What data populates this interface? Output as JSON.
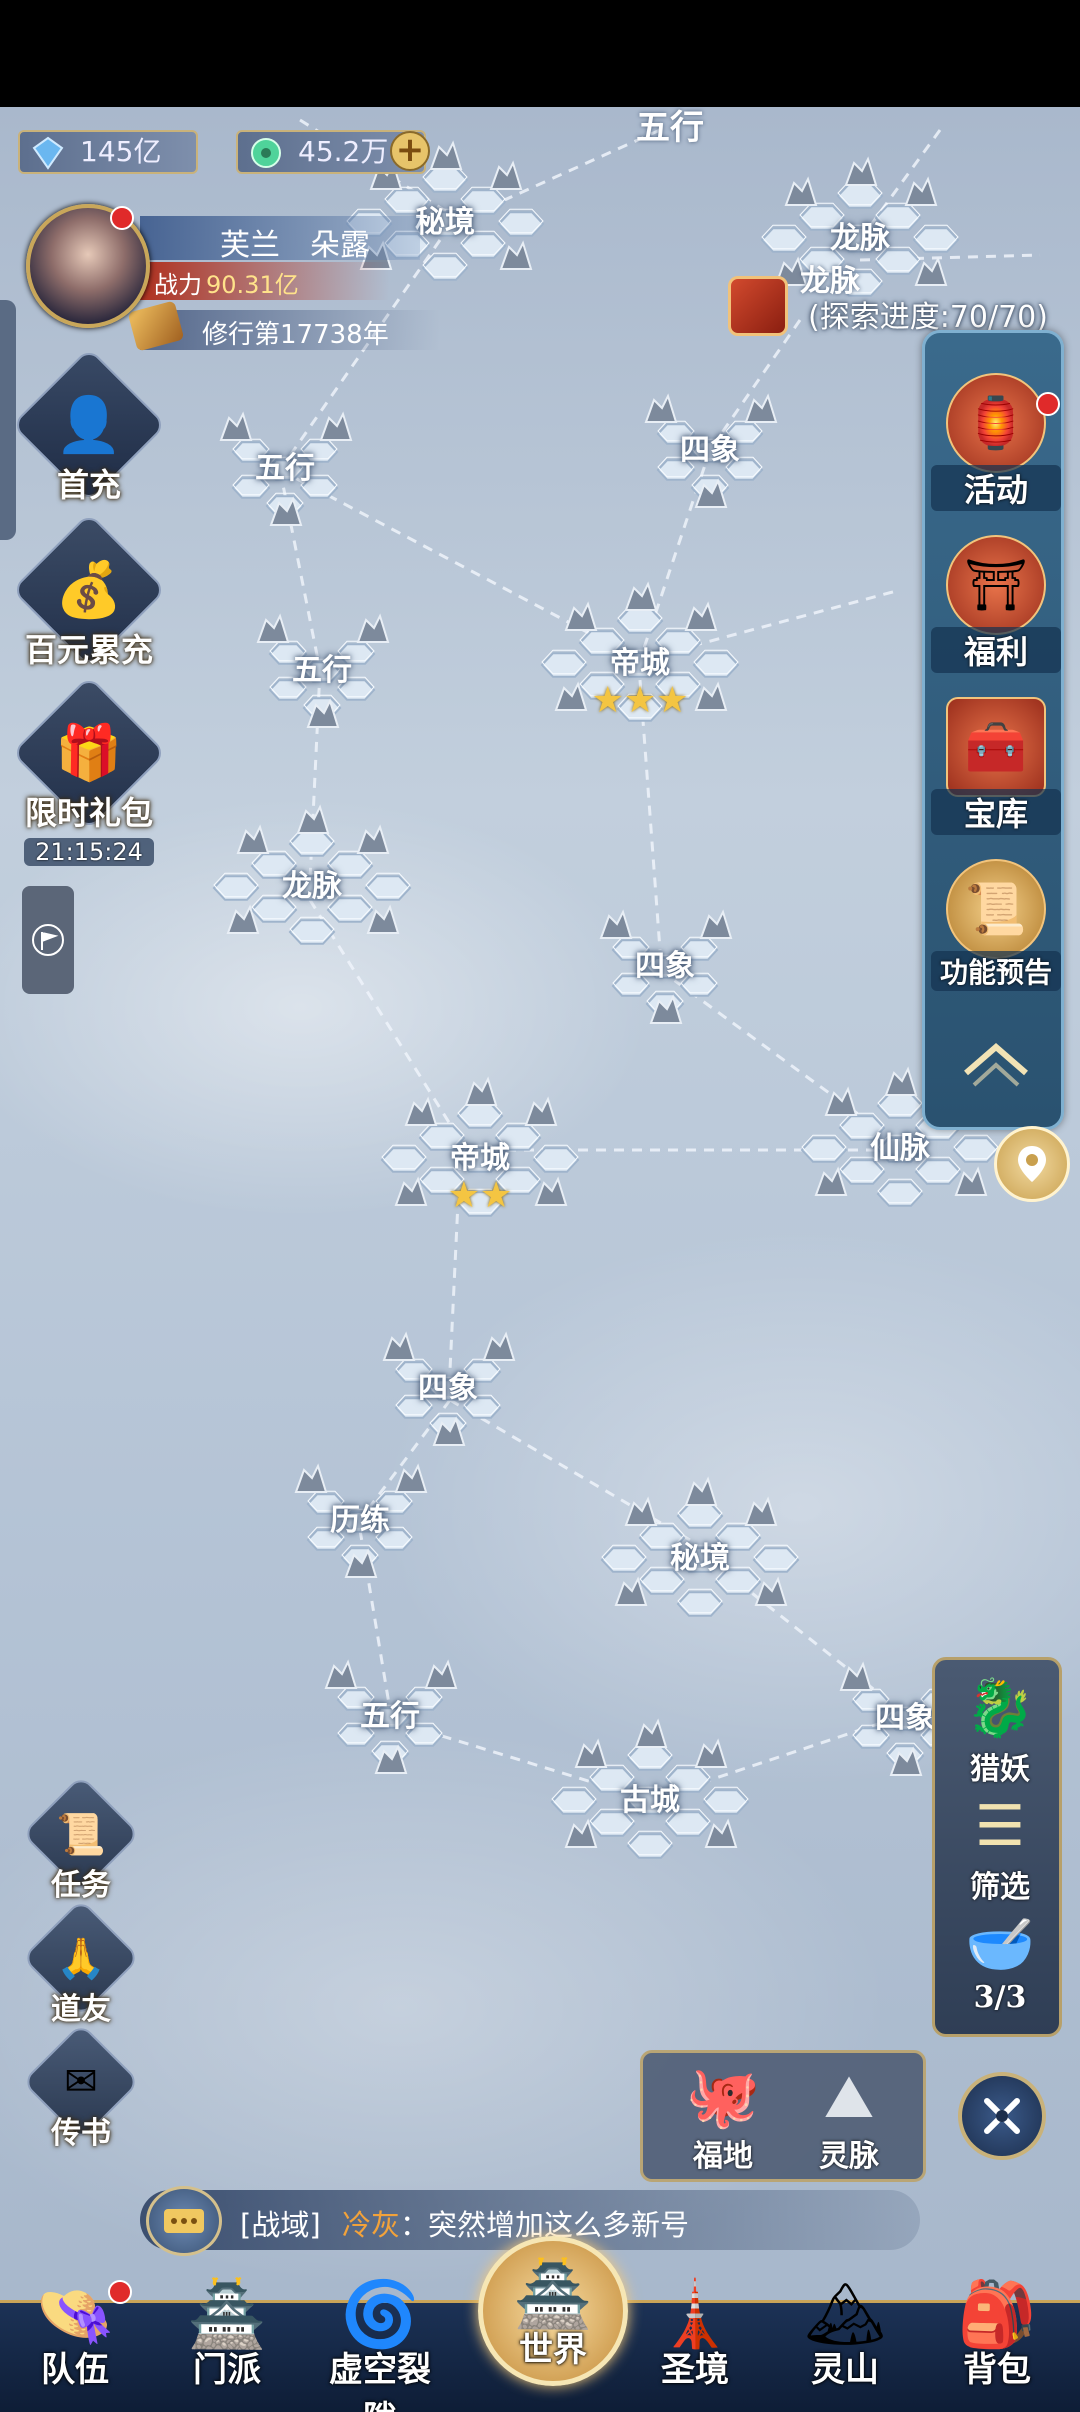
{
  "currencies": [
    {
      "name": "spirit-stone",
      "value": "145亿",
      "icon": "crystal-icon",
      "color": "#6ab7f0"
    },
    {
      "name": "jade",
      "value": "45.2万",
      "icon": "jade-coin-icon",
      "color": "#4fd39a"
    }
  ],
  "player": {
    "name": "芙兰　朵露",
    "power_label": "战力",
    "power_value": "90.31亿",
    "cultivation": "修行第17738年"
  },
  "left_buttons": [
    {
      "label": "首充",
      "icon": "warrior-portrait-icon"
    },
    {
      "label": "百元累充",
      "icon": "money-bag-icon"
    },
    {
      "label": "限时礼包",
      "icon": "gift-bag-icon",
      "timer": "21:15:24"
    }
  ],
  "left_bottom_buttons": [
    {
      "label": "任务",
      "icon": "scroll-icon"
    },
    {
      "label": "道友",
      "icon": "friends-icon"
    },
    {
      "label": "传书",
      "icon": "letter-icon"
    }
  ],
  "right_panel": [
    {
      "label": "活动",
      "icon": "lantern-icon"
    },
    {
      "label": "福利",
      "icon": "pavilion-icon"
    },
    {
      "label": "宝库",
      "icon": "treasure-chest-icon"
    },
    {
      "label": "功能预告",
      "icon": "scroll-preview-icon"
    }
  ],
  "right_lower_panel": [
    {
      "label": "猎妖",
      "icon": "beast-icon"
    },
    {
      "label": "筛选",
      "icon": "filter-icon"
    },
    {
      "label": "3/3",
      "icon": "bowl-icon"
    }
  ],
  "popup_buttons": [
    {
      "label": "福地",
      "icon": "octopus-icon"
    },
    {
      "label": "灵脉",
      "icon": "vein-icon"
    }
  ],
  "map": {
    "top_partial_label": "五行",
    "explore": {
      "node": "龙脉",
      "progress": "(探索进度:70/70)"
    },
    "nodes": [
      {
        "id": "mijing-top",
        "label": "秘境",
        "stars": ""
      },
      {
        "id": "longmai-top",
        "label": "龙脉",
        "stars": ""
      },
      {
        "id": "wuxing-1",
        "label": "五行",
        "stars": ""
      },
      {
        "id": "sixiang-1",
        "label": "四象",
        "stars": ""
      },
      {
        "id": "dicheng-1",
        "label": "帝城",
        "stars": "★★★"
      },
      {
        "id": "wuxing-2",
        "label": "五行",
        "stars": ""
      },
      {
        "id": "longmai-2",
        "label": "龙脉",
        "stars": ""
      },
      {
        "id": "sixiang-2",
        "label": "四象",
        "stars": ""
      },
      {
        "id": "dicheng-2",
        "label": "帝城",
        "stars": "★★"
      },
      {
        "id": "xianmai",
        "label": "仙脉",
        "stars": ""
      },
      {
        "id": "sixiang-3",
        "label": "四象",
        "stars": ""
      },
      {
        "id": "lilian",
        "label": "历练",
        "stars": ""
      },
      {
        "id": "mijing-2",
        "label": "秘境",
        "stars": ""
      },
      {
        "id": "wuxing-3",
        "label": "五行",
        "stars": ""
      },
      {
        "id": "gucheng",
        "label": "古城",
        "stars": ""
      },
      {
        "id": "sixiang-4",
        "label": "四象",
        "stars": ""
      }
    ]
  },
  "chat": {
    "channel": "[战域]",
    "sender": "冷灰",
    "sep": "：",
    "message": "突然增加这么多新号"
  },
  "nav": [
    {
      "label": "队伍",
      "icon": "straw-hat-icon"
    },
    {
      "label": "门派",
      "icon": "temple-icon"
    },
    {
      "label": "虚空裂隙",
      "icon": "vortex-icon"
    },
    {
      "label": "世界",
      "icon": "palace-icon"
    },
    {
      "label": "圣境",
      "icon": "tower-icon"
    },
    {
      "label": "灵山",
      "icon": "mountain-icon"
    },
    {
      "label": "背包",
      "icon": "backpack-icon"
    }
  ]
}
